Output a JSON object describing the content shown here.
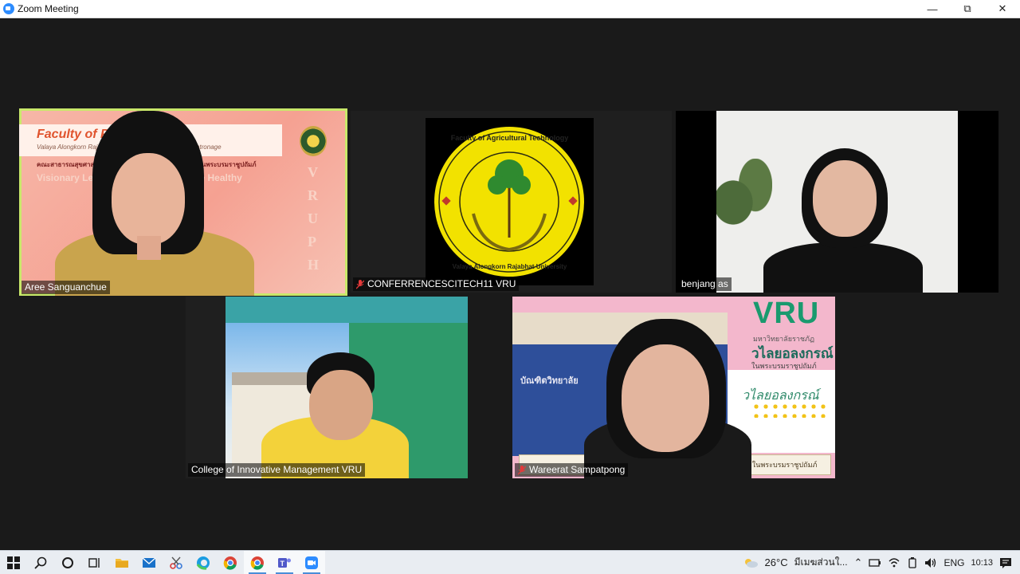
{
  "window": {
    "title": "Zoom Meeting",
    "controls": {
      "minimize": "—",
      "maximize": "⧉",
      "close": "✕"
    }
  },
  "participants": [
    {
      "name": "Aree Sanguanchue",
      "muted": false,
      "speaking": true,
      "background_heading": "Faculty of Public Health",
      "background_sub": "Valaya Alongkorn Rajabhat University under the Royal Patronage",
      "background_thai": "คณะสาธารณสุขศาสตร์ มหาวิทยาลัยราชภัฏวไลยอลงกรณ์ ในพระบรมราชูปถัมภ์",
      "background_motto": "Visionary Leadership for Sustainable Healthy",
      "background_vertical": "VRUPH"
    },
    {
      "name": "CONFERRENCESCITECH11 VRU",
      "muted": true,
      "speaking": false,
      "logo_top": "Faculty of Agricultural Technology",
      "logo_bottom": "Valaya Alongkorn Rajabhat University"
    },
    {
      "name": "benjang as",
      "muted": false,
      "speaking": false
    },
    {
      "name": "College of Innovative Management VRU",
      "muted": false,
      "speaking": false
    },
    {
      "name": "Wareerat Sampatpong",
      "muted": true,
      "speaking": false,
      "bg_logo": "VRU",
      "bg_thai_1": "มหาวิทยาลัยราชภัฏ",
      "bg_thai_2": "วไลยอลงกรณ์",
      "bg_thai_3": "ในพระบรมราชูปถัมภ์",
      "bg_wall_thai": "บัณฑิตวิทยาลัย",
      "bg_banner_thai": "ภัฏวไลยอลงกรณ์ ในพระบรมราชูปถัมภ์",
      "bg_script": "วไลยอลงกรณ์"
    }
  ],
  "taskbar": {
    "weather": "26°C",
    "weather_text": "มีเมฆส่วนใ...",
    "language": "ENG",
    "time": "10:13"
  },
  "colors": {
    "speaker_outline": "#c9e86a",
    "zoom_blue": "#2d8cff",
    "muted_red": "#e5393a"
  }
}
